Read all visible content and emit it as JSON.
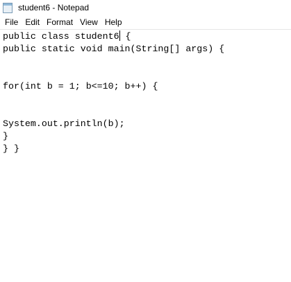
{
  "window": {
    "title": "student6 - Notepad"
  },
  "menu": [
    "File",
    "Edit",
    "Format",
    "View",
    "Help"
  ],
  "editor": {
    "lines": [
      "public class student6",
      " {",
      "public static void main(String[] args) {",
      "",
      "",
      "for(int b = 1; b<=10; b++) {",
      "",
      "",
      "System.out.println(b);",
      "}",
      "} }"
    ]
  }
}
